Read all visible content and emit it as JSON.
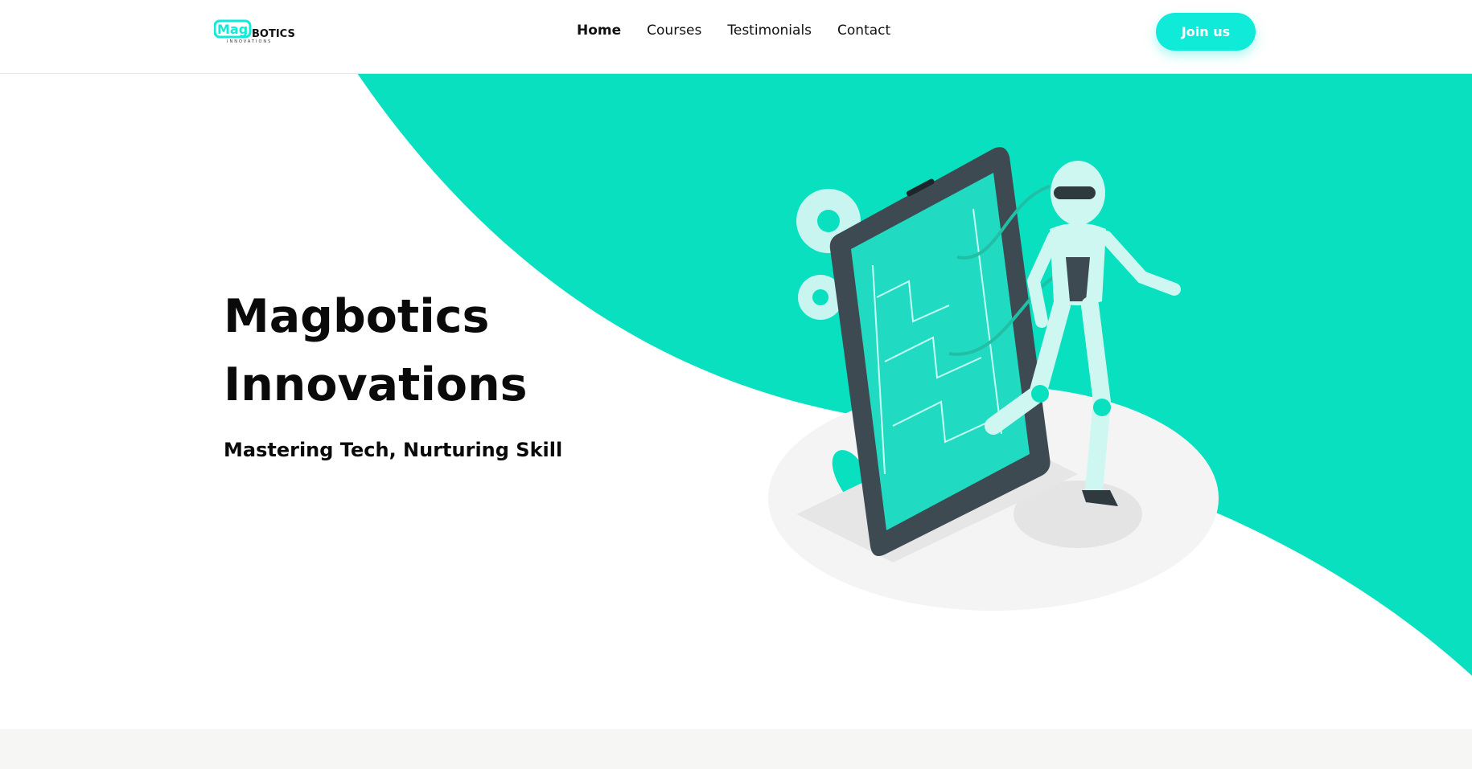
{
  "brand": {
    "logo_main": "Mag",
    "logo_rest": "BOTICS",
    "logo_tagline": "INNOVATIONS"
  },
  "nav": {
    "links": [
      "Home",
      "Courses",
      "Testimonials",
      "Contact"
    ],
    "active": "Home",
    "cta_label": "Join us"
  },
  "hero": {
    "title_line1": "Magbotics",
    "title_line2": "Innovations",
    "subtitle": "Mastering Tech, Nurturing Skill"
  },
  "colors": {
    "accent": "#10ebd9",
    "hero_wave": "#08e0c0",
    "bottom_band": "#f6f6f4"
  },
  "icons": {
    "illustration": "robot-phone-illustration",
    "gears": "gear-icon"
  }
}
